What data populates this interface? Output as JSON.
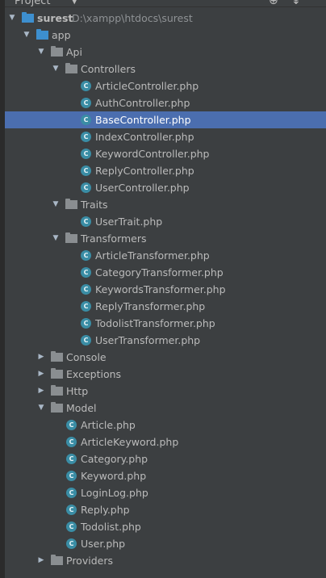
{
  "header": {
    "title": "Project",
    "locate_icon": "crosshair-icon",
    "collapse_icon": "collapse-all-icon"
  },
  "tree": {
    "root": {
      "label": "surest",
      "path": "D:\\xampp\\htdocs\\surest"
    },
    "app": "app",
    "api": "Api",
    "controllers": {
      "label": "Controllers",
      "files": [
        "ArticleController.php",
        "AuthController.php",
        "BaseController.php",
        "IndexController.php",
        "KeywordController.php",
        "ReplyController.php",
        "UserController.php"
      ]
    },
    "traits": {
      "label": "Traits",
      "files": [
        "UserTrait.php"
      ]
    },
    "transformers": {
      "label": "Transformers",
      "files": [
        "ArticleTransformer.php",
        "CategoryTransformer.php",
        "KeywordsTransformer.php",
        "ReplyTransformer.php",
        "TodolistTransformer.php",
        "UserTransformer.php"
      ]
    },
    "console": "Console",
    "exceptions": "Exceptions",
    "http": "Http",
    "model": {
      "label": "Model",
      "files": [
        "Article.php",
        "ArticleKeyword.php",
        "Category.php",
        "Keyword.php",
        "LoginLog.php",
        "Reply.php",
        "Todolist.php",
        "User.php"
      ]
    },
    "providers": "Providers",
    "selected_file": "BaseController.php"
  },
  "colors": {
    "background": "#3c3f41",
    "selection": "#4b6eaf",
    "php_icon": "#3a8da5",
    "module_folder": "#3d8fcf",
    "folder": "#8a8e91"
  }
}
